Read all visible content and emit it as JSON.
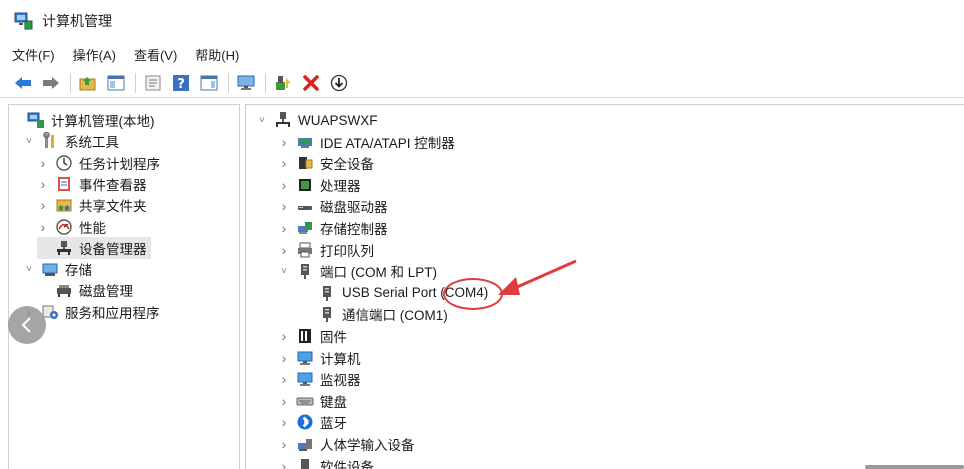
{
  "window": {
    "title": "计算机管理"
  },
  "menu": [
    "文件(F)",
    "操作(A)",
    "查看(V)",
    "帮助(H)"
  ],
  "toolbar_buttons": [
    "back-icon",
    "forward-icon",
    "up-folder-icon",
    "show-hide-tree-icon",
    "properties-icon",
    "help-icon",
    "action-pane-icon",
    "monitor-icon",
    "update-driver-icon",
    "uninstall-icon",
    "download-icon"
  ],
  "left_tree": [
    {
      "label": "计算机管理(本地)",
      "icon": "computer-management-icon",
      "level": 0,
      "expander": "none"
    },
    {
      "label": "系统工具",
      "icon": "tools-icon",
      "level": 1,
      "expander": "expanded"
    },
    {
      "label": "任务计划程序",
      "icon": "clock-icon",
      "level": 2,
      "expander": "collapsed"
    },
    {
      "label": "事件查看器",
      "icon": "event-viewer-icon",
      "level": 2,
      "expander": "collapsed"
    },
    {
      "label": "共享文件夹",
      "icon": "shared-folder-icon",
      "level": 2,
      "expander": "collapsed"
    },
    {
      "label": "性能",
      "icon": "performance-icon",
      "level": 2,
      "expander": "collapsed"
    },
    {
      "label": "设备管理器",
      "icon": "device-manager-icon",
      "level": 2,
      "expander": "none",
      "selected": true
    },
    {
      "label": "存储",
      "icon": "storage-icon",
      "level": 1,
      "expander": "expanded"
    },
    {
      "label": "磁盘管理",
      "icon": "disk-management-icon",
      "level": 2,
      "expander": "none"
    },
    {
      "label": "服务和应用程序",
      "icon": "services-icon",
      "level": 1,
      "expander": "collapsed"
    }
  ],
  "right_tree": [
    {
      "label": "WUAPSWXF",
      "icon": "computer-root-icon",
      "level": 0,
      "expander": "expanded"
    },
    {
      "label": "IDE ATA/ATAPI 控制器",
      "icon": "ide-controller-icon",
      "level": 1,
      "expander": "collapsed"
    },
    {
      "label": "安全设备",
      "icon": "security-device-icon",
      "level": 1,
      "expander": "collapsed"
    },
    {
      "label": "处理器",
      "icon": "processor-icon",
      "level": 1,
      "expander": "collapsed"
    },
    {
      "label": "磁盘驱动器",
      "icon": "disk-drive-icon",
      "level": 1,
      "expander": "collapsed"
    },
    {
      "label": "存储控制器",
      "icon": "storage-controller-icon",
      "level": 1,
      "expander": "collapsed"
    },
    {
      "label": "打印队列",
      "icon": "print-queue-icon",
      "level": 1,
      "expander": "collapsed"
    },
    {
      "label": "端口 (COM 和 LPT)",
      "icon": "port-icon",
      "level": 1,
      "expander": "expanded"
    },
    {
      "label": "USB Serial Port (COM4)",
      "icon": "port-icon",
      "level": 2,
      "expander": "none"
    },
    {
      "label": "通信端口 (COM1)",
      "icon": "port-icon",
      "level": 2,
      "expander": "none"
    },
    {
      "label": "固件",
      "icon": "firmware-icon",
      "level": 1,
      "expander": "collapsed"
    },
    {
      "label": "计算机",
      "icon": "computer-icon",
      "level": 1,
      "expander": "collapsed"
    },
    {
      "label": "监视器",
      "icon": "monitor-icon",
      "level": 1,
      "expander": "collapsed"
    },
    {
      "label": "键盘",
      "icon": "keyboard-icon",
      "level": 1,
      "expander": "collapsed"
    },
    {
      "label": "蓝牙",
      "icon": "bluetooth-icon",
      "level": 1,
      "expander": "collapsed"
    },
    {
      "label": "人体学输入设备",
      "icon": "hid-icon",
      "level": 1,
      "expander": "collapsed"
    },
    {
      "label": "软件设备",
      "icon": "software-device-icon",
      "level": 1,
      "expander": "collapsed"
    }
  ],
  "annotation_color": "#e23b3b"
}
